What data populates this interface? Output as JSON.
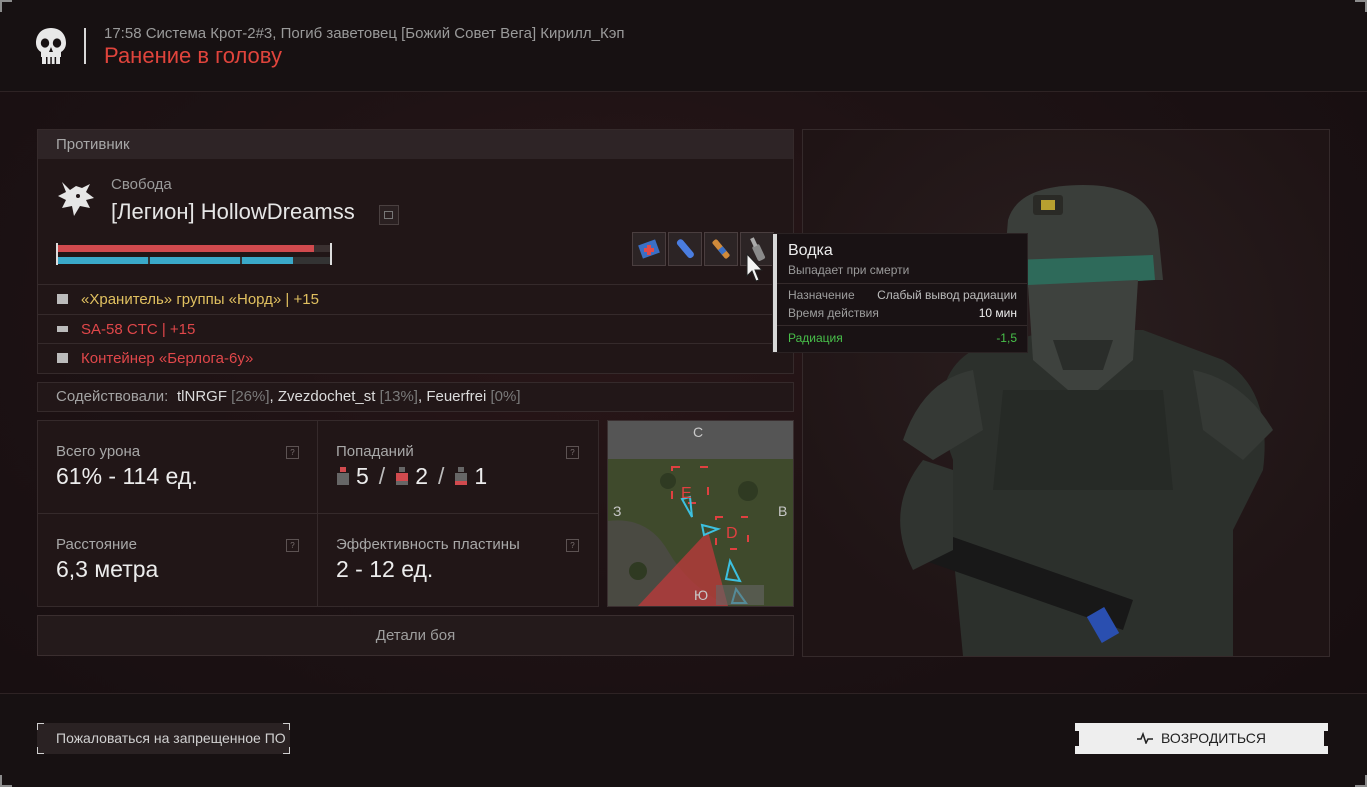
{
  "header": {
    "event_line": "17:58 Система Крот-2#3, Погиб заветовец [Божий Совет Вега] Кирилл_Кэп",
    "title": "Ранение в голову"
  },
  "enemy": {
    "section_label": "Противник",
    "faction": "Свобода",
    "name": "[Легион] HollowDreamss",
    "health_percent": 94,
    "armor_percent": 86,
    "loot": [
      {
        "text": "«Хранитель» группы «Норд» | +15",
        "color": "#e0c060",
        "icon": "armor-icon"
      },
      {
        "text": "SA-58 CTC | +15",
        "color": "#e0474a",
        "icon": "rifle-icon"
      },
      {
        "text": "Контейнер «Берлога-6у»",
        "color": "#e0474a",
        "icon": "container-icon"
      }
    ],
    "quick_slots": [
      "medkit-icon",
      "injector-icon",
      "stimulant-icon",
      "vodka-bottle-icon"
    ]
  },
  "assist": {
    "label": "Содействовали:",
    "players": [
      {
        "name": "tlNRGF",
        "pct": "[26%]"
      },
      {
        "name": "Zvezdochet_st",
        "pct": "[13%]"
      },
      {
        "name": "Feuerfrei",
        "pct": "[0%]"
      }
    ]
  },
  "stats": {
    "damage_label": "Всего урона",
    "damage_value": "61% - 114 ед.",
    "hits_label": "Попаданий",
    "hits": [
      "5",
      "2",
      "1"
    ],
    "distance_label": "Расстояние",
    "distance_value": "6,3 метра",
    "plate_label": "Эффективность пластины",
    "plate_value": "2 - 12 ед.",
    "help_glyph": "?"
  },
  "minimap": {
    "north": "С",
    "south": "Ю",
    "west": "З",
    "east": "В",
    "marker_e": "E",
    "marker_d": "D"
  },
  "tooltip": {
    "title": "Водка",
    "subtitle": "Выпадает при смерти",
    "rows": [
      {
        "label": "Назначение",
        "value": "Слабый вывод радиации"
      },
      {
        "label": "Время действия",
        "value": "10 мин"
      }
    ],
    "effect": {
      "label": "Радиация",
      "value": "-1,5"
    }
  },
  "footer": {
    "report_label": "Пожаловаться на запрещенное ПО",
    "respawn_label": "ВОЗРОДИТЬСЯ"
  },
  "colors": {
    "accent_red": "#e0443c",
    "health": "#d14a4e",
    "armor": "#3aa9c9",
    "positive": "#48c04a"
  }
}
